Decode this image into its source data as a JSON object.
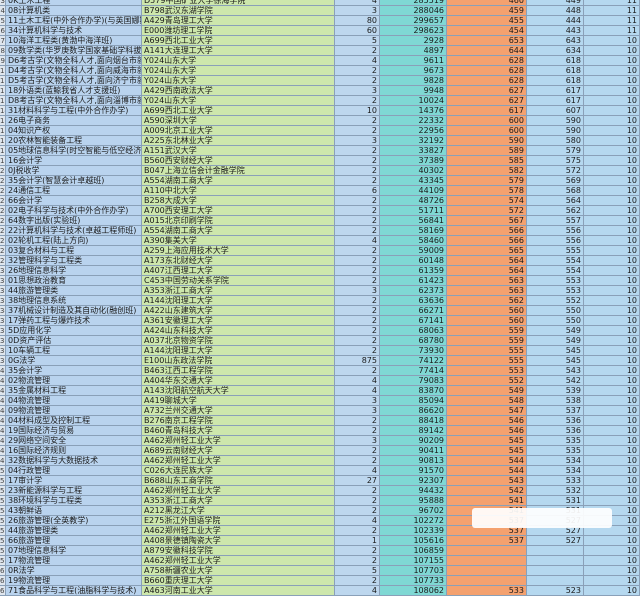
{
  "rows": [
    {
      "n": "3",
      "major": "0K土木工程",
      "school": "D579中国矿业大学徐海学院",
      "plan": "4",
      "rank": "285519",
      "score": "460",
      "low": "449",
      "c7": "11"
    },
    {
      "n": "4",
      "major": "08计算机类",
      "school": "B798武汉东湖学院",
      "plan": "3",
      "rank": "288046",
      "score": "459",
      "low": "448",
      "c7": "11"
    },
    {
      "n": "5",
      "major": "11土木工程(中外合作办学)(与英国娜斯大学合作",
      "school": "A429青岛理工大学",
      "plan": "80",
      "rank": "299657",
      "score": "455",
      "low": "444",
      "c7": "11"
    },
    {
      "n": "6",
      "major": "34计算机科学与技术",
      "school": "E000潍坊理工学院",
      "plan": "60",
      "rank": "298623",
      "score": "454",
      "low": "443",
      "c7": "11"
    },
    {
      "n": "7",
      "major": "10海洋工程类(黄渤中海洋班)",
      "school": "A699西北工业大学",
      "plan": "5",
      "rank": "2928",
      "score": "653",
      "low": "643",
      "c7": "10"
    },
    {
      "n": "8",
      "major": "09数学类(华罗庚数学国家基础学科拔尖计划班)",
      "school": "A141大连理工大学",
      "plan": "2",
      "rank": "4897",
      "score": "644",
      "low": "634",
      "c7": "10"
    },
    {
      "n": "9",
      "major": "D6考古学(文物全科人才,面向烟台市就业)",
      "school": "Y024山东大学",
      "plan": "4",
      "rank": "9611",
      "score": "628",
      "low": "618",
      "c7": "10"
    },
    {
      "n": "10",
      "major": "D4考古学(文物全科人才,面向威海市就业)",
      "school": "Y024山东大学",
      "plan": "2",
      "rank": "9673",
      "score": "628",
      "low": "618",
      "c7": "10"
    },
    {
      "n": "11",
      "major": "D5考古学(文物全科人才,面向济宁市就业)",
      "school": "Y024山东大学",
      "plan": "2",
      "rank": "9828",
      "score": "628",
      "low": "618",
      "c7": "10"
    },
    {
      "n": "12",
      "major": "18外语类(蓝鲸我省人才支援班)",
      "school": "A429西南政法大学",
      "plan": "3",
      "rank": "9948",
      "score": "627",
      "low": "617",
      "c7": "10"
    },
    {
      "n": "13",
      "major": "D8考古学(文物全科人才,面向淄博市就业)",
      "school": "Y024山东大学",
      "plan": "2",
      "rank": "10024",
      "score": "627",
      "low": "617",
      "c7": "10"
    },
    {
      "n": "14",
      "major": "31材料科学与工程(中外合作办学)",
      "school": "A699西北工业大学",
      "plan": "10",
      "rank": "14376",
      "score": "617",
      "low": "607",
      "c7": "10"
    },
    {
      "n": "15",
      "major": "26电子商务",
      "school": "A590深圳大学",
      "plan": "2",
      "rank": "22332",
      "score": "600",
      "low": "590",
      "c7": "10"
    },
    {
      "n": "16",
      "major": "04知识产权",
      "school": "A009北京工业大学",
      "plan": "2",
      "rank": "22956",
      "score": "600",
      "low": "590",
      "c7": "10"
    },
    {
      "n": "17",
      "major": "20农林智能装备工程",
      "school": "A225东北林业大学",
      "plan": "3",
      "rank": "32192",
      "score": "590",
      "low": "580",
      "c7": "10"
    },
    {
      "n": "18",
      "major": "05地球信息科学(时空智能与低空经济创新实验班)",
      "school": "A151武汉大学",
      "plan": "2",
      "rank": "33827",
      "score": "589",
      "low": "579",
      "c7": "10"
    },
    {
      "n": "19",
      "major": "16会计学",
      "school": "B560西安财经大学",
      "plan": "2",
      "rank": "37389",
      "score": "585",
      "low": "575",
      "c7": "10"
    },
    {
      "n": "20",
      "major": "0J税收学",
      "school": "B047上海立信会计金融学院",
      "plan": "2",
      "rank": "40302",
      "score": "582",
      "low": "572",
      "c7": "10"
    },
    {
      "n": "21",
      "major": "35会计学(智慧会计卓越班)",
      "school": "A554湖南工商大学",
      "plan": "2",
      "rank": "43345",
      "score": "579",
      "low": "569",
      "c7": "10"
    },
    {
      "n": "22",
      "major": "24通信工程",
      "school": "A110中北大学",
      "plan": "6",
      "rank": "44109",
      "score": "578",
      "low": "568",
      "c7": "10"
    },
    {
      "n": "23",
      "major": "66会计学",
      "school": "B258大成大学",
      "plan": "2",
      "rank": "48726",
      "score": "574",
      "low": "564",
      "c7": "10"
    },
    {
      "n": "24",
      "major": "02电子科学与技术(中外合作办学)",
      "school": "A700西安理工大学",
      "plan": "2",
      "rank": "51711",
      "score": "572",
      "low": "562",
      "c7": "10"
    },
    {
      "n": "25",
      "major": "64数字出版(实验班)",
      "school": "A015北京印刷学院",
      "plan": "2",
      "rank": "56841",
      "score": "567",
      "low": "557",
      "c7": "10"
    },
    {
      "n": "26",
      "major": "22计算机科学与技术(卓越工程师班)",
      "school": "A554湖南工商大学",
      "plan": "2",
      "rank": "58169",
      "score": "566",
      "low": "556",
      "c7": "10"
    },
    {
      "n": "27",
      "major": "02轮机工程(陆上方向)",
      "school": "A390集美大学",
      "plan": "4",
      "rank": "58460",
      "score": "566",
      "low": "556",
      "c7": "10"
    },
    {
      "n": "28",
      "major": "03复合材料与工程",
      "school": "A259上海应用技术大学",
      "plan": "2",
      "rank": "59009",
      "score": "565",
      "low": "555",
      "c7": "10"
    },
    {
      "n": "29",
      "major": "32管理科学与工程类",
      "school": "A173东北财经大学",
      "plan": "2",
      "rank": "60148",
      "score": "564",
      "low": "554",
      "c7": "10"
    },
    {
      "n": "30",
      "major": "26地理信息科学",
      "school": "A407江西理工大学",
      "plan": "2",
      "rank": "61359",
      "score": "564",
      "low": "554",
      "c7": "10"
    },
    {
      "n": "31",
      "major": "01思想政治教育",
      "school": "C453中国劳动关系学院",
      "plan": "2",
      "rank": "61423",
      "score": "563",
      "low": "553",
      "c7": "10"
    },
    {
      "n": "32",
      "major": "44旅游管理类",
      "school": "A353浙江工商大学",
      "plan": "3",
      "rank": "62373",
      "score": "563",
      "low": "553",
      "c7": "10"
    },
    {
      "n": "33",
      "major": "38地理信息系统",
      "school": "A144沈阳理工大学",
      "plan": "2",
      "rank": "63636",
      "score": "562",
      "low": "552",
      "c7": "10"
    },
    {
      "n": "34",
      "major": "37机械设计制造及其自动化(融创班)",
      "school": "A422山东建筑大学",
      "plan": "2",
      "rank": "66271",
      "score": "560",
      "low": "550",
      "c7": "10"
    },
    {
      "n": "35",
      "major": "17弹药工程与爆炸技术",
      "school": "A361安徽理工大学",
      "plan": "2",
      "rank": "67141",
      "score": "560",
      "low": "550",
      "c7": "10"
    },
    {
      "n": "36",
      "major": "5D应用化学",
      "school": "A424山东科技大学",
      "plan": "2",
      "rank": "68063",
      "score": "559",
      "low": "549",
      "c7": "10"
    },
    {
      "n": "37",
      "major": "0D资产评估",
      "school": "A037北京物资学院",
      "plan": "2",
      "rank": "68780",
      "score": "559",
      "low": "549",
      "c7": "10"
    },
    {
      "n": "38",
      "major": "10车辆工程",
      "school": "A144沈阳理工大学",
      "plan": "2",
      "rank": "73930",
      "score": "555",
      "low": "545",
      "c7": "10"
    },
    {
      "n": "39",
      "major": "0G法学",
      "school": "E100山东政法学院",
      "plan": "875",
      "rank": "74122",
      "score": "555",
      "low": "545",
      "c7": "10"
    },
    {
      "n": "40",
      "major": "35会计学",
      "school": "B463江西工程学院",
      "plan": "2",
      "rank": "77414",
      "score": "553",
      "low": "543",
      "c7": "10"
    },
    {
      "n": "41",
      "major": "02物流管理",
      "school": "A404华东交通大学",
      "plan": "4",
      "rank": "79083",
      "score": "552",
      "low": "542",
      "c7": "10"
    },
    {
      "n": "42",
      "major": "35金属材料工程",
      "school": "A143沈阳航空航天大学",
      "plan": "4",
      "rank": "83870",
      "score": "549",
      "low": "539",
      "c7": "10"
    },
    {
      "n": "43",
      "major": "04物流管理",
      "school": "A419聊城大学",
      "plan": "3",
      "rank": "85094",
      "score": "548",
      "low": "538",
      "c7": "10"
    },
    {
      "n": "44",
      "major": "09物流管理",
      "school": "A732兰州交通大学",
      "plan": "3",
      "rank": "86620",
      "score": "547",
      "low": "537",
      "c7": "10"
    },
    {
      "n": "45",
      "major": "04材料成型及控制工程",
      "school": "B276南京工程学院",
      "plan": "2",
      "rank": "88418",
      "score": "546",
      "low": "536",
      "c7": "10"
    },
    {
      "n": "46",
      "major": "19国际经济与贸易",
      "school": "B460青岛科技大学",
      "plan": "2",
      "rank": "89142",
      "score": "546",
      "low": "536",
      "c7": "10"
    },
    {
      "n": "47",
      "major": "29网络空间安全",
      "school": "A462郑州轻工业大学",
      "plan": "3",
      "rank": "90209",
      "score": "545",
      "low": "535",
      "c7": "10"
    },
    {
      "n": "48",
      "major": "16国际经济规则",
      "school": "A689云南财经大学",
      "plan": "2",
      "rank": "90411",
      "score": "545",
      "low": "535",
      "c7": "10"
    },
    {
      "n": "49",
      "major": "32数据科学与大数据技术",
      "school": "A462郑州轻工业大学",
      "plan": "2",
      "rank": "90813",
      "score": "544",
      "low": "534",
      "c7": "10"
    },
    {
      "n": "50",
      "major": "04行政管理",
      "school": "C026大连民族大学",
      "plan": "4",
      "rank": "91570",
      "score": "544",
      "low": "534",
      "c7": "10"
    },
    {
      "n": "51",
      "major": "17审计学",
      "school": "B688山东工商学院",
      "plan": "27",
      "rank": "92307",
      "score": "543",
      "low": "533",
      "c7": "10"
    },
    {
      "n": "52",
      "major": "23新能源科学与工程",
      "school": "A462郑州轻工业大学",
      "plan": "2",
      "rank": "94432",
      "score": "542",
      "low": "532",
      "c7": "10"
    },
    {
      "n": "53",
      "major": "38环境科学与工程类",
      "school": "A353浙江工商大学",
      "plan": "2",
      "rank": "95888",
      "score": "541",
      "low": "531",
      "c7": "10"
    },
    {
      "n": "54",
      "major": "43朝鲜语",
      "school": "A212黑龙江大学",
      "plan": "2",
      "rank": "96702",
      "score": "541",
      "low": "531",
      "c7": "10"
    },
    {
      "n": "55",
      "major": "26旅游管理(全英教学)",
      "school": "E275浙江外国语学院",
      "plan": "4",
      "rank": "102272",
      "score": "537",
      "low": "527",
      "c7": "10"
    },
    {
      "n": "56",
      "major": "44旅游管理类",
      "school": "A462郑州轻工业大学",
      "plan": "2",
      "rank": "102339",
      "score": "537",
      "low": "527",
      "c7": "10"
    },
    {
      "n": "57",
      "major": "66旅游管理",
      "school": "A408景德镇陶瓷大学",
      "plan": "1",
      "rank": "105616",
      "score": "537",
      "low": "527",
      "c7": "10"
    },
    {
      "n": "58",
      "major": "07地理信息科学",
      "school": "A879安徽科技学院",
      "plan": "2",
      "rank": "106859",
      "score": "",
      "low": "",
      "c7": "10"
    },
    {
      "n": "59",
      "major": "17物流管理",
      "school": "A462郑州轻工业大学",
      "plan": "2",
      "rank": "107155",
      "score": "",
      "low": "",
      "c7": "10"
    },
    {
      "n": "60",
      "major": "0R法学",
      "school": "A758新疆农业大学",
      "plan": "5",
      "rank": "107703",
      "score": "",
      "low": "",
      "c7": "10"
    },
    {
      "n": "61",
      "major": "19物流管理",
      "school": "B660重庆理工大学",
      "plan": "2",
      "rank": "107733",
      "score": "",
      "low": "",
      "c7": "10"
    },
    {
      "n": "62",
      "major": "71食品科学与工程(油脂科学与技术)",
      "school": "A463河南工业大学",
      "plan": "4",
      "rank": "108062",
      "score": "533",
      "low": "523",
      "c7": "10"
    }
  ]
}
